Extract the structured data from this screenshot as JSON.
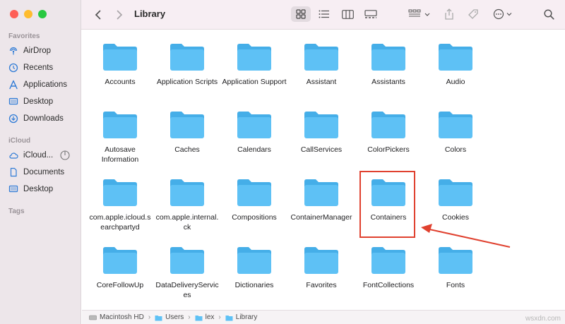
{
  "window": {
    "title": "Library"
  },
  "sidebar": {
    "favorites_heading": "Favorites",
    "favorites": [
      {
        "label": "AirDrop",
        "icon": "airdrop-icon"
      },
      {
        "label": "Recents",
        "icon": "clock-icon"
      },
      {
        "label": "Applications",
        "icon": "applications-icon"
      },
      {
        "label": "Desktop",
        "icon": "desktop-icon"
      },
      {
        "label": "Downloads",
        "icon": "download-icon"
      }
    ],
    "icloud_heading": "iCloud",
    "icloud": [
      {
        "label": "iCloud...",
        "icon": "cloud-icon"
      },
      {
        "label": "Documents",
        "icon": "document-icon"
      },
      {
        "label": "Desktop",
        "icon": "desktop-icon"
      }
    ],
    "tags_heading": "Tags"
  },
  "folders": [
    {
      "label": "Accounts"
    },
    {
      "label": "Application Scripts"
    },
    {
      "label": "Application Support"
    },
    {
      "label": "Assistant"
    },
    {
      "label": "Assistants"
    },
    {
      "label": "Audio"
    },
    {
      "label": "Autosave Information"
    },
    {
      "label": "Caches"
    },
    {
      "label": "Calendars"
    },
    {
      "label": "CallServices"
    },
    {
      "label": "ColorPickers"
    },
    {
      "label": "Colors"
    },
    {
      "label": "com.apple.icloud.searchpartyd"
    },
    {
      "label": "com.apple.internal.ck"
    },
    {
      "label": "Compositions"
    },
    {
      "label": "ContainerManager"
    },
    {
      "label": "Containers",
      "highlighted": true
    },
    {
      "label": "Cookies"
    },
    {
      "label": "CoreFollowUp"
    },
    {
      "label": "DataDeliveryServices"
    },
    {
      "label": "Dictionaries"
    },
    {
      "label": "Favorites"
    },
    {
      "label": "FontCollections"
    },
    {
      "label": "Fonts"
    }
  ],
  "pathbar": [
    "Macintosh HD",
    "Users",
    "lex",
    "Library"
  ],
  "watermark": "wsxdn.com",
  "colors": {
    "folder": "#5ec1f5",
    "folder_tab": "#45aee8",
    "highlight": "#e0412f",
    "sidebar_icon": "#2f7bd6"
  }
}
